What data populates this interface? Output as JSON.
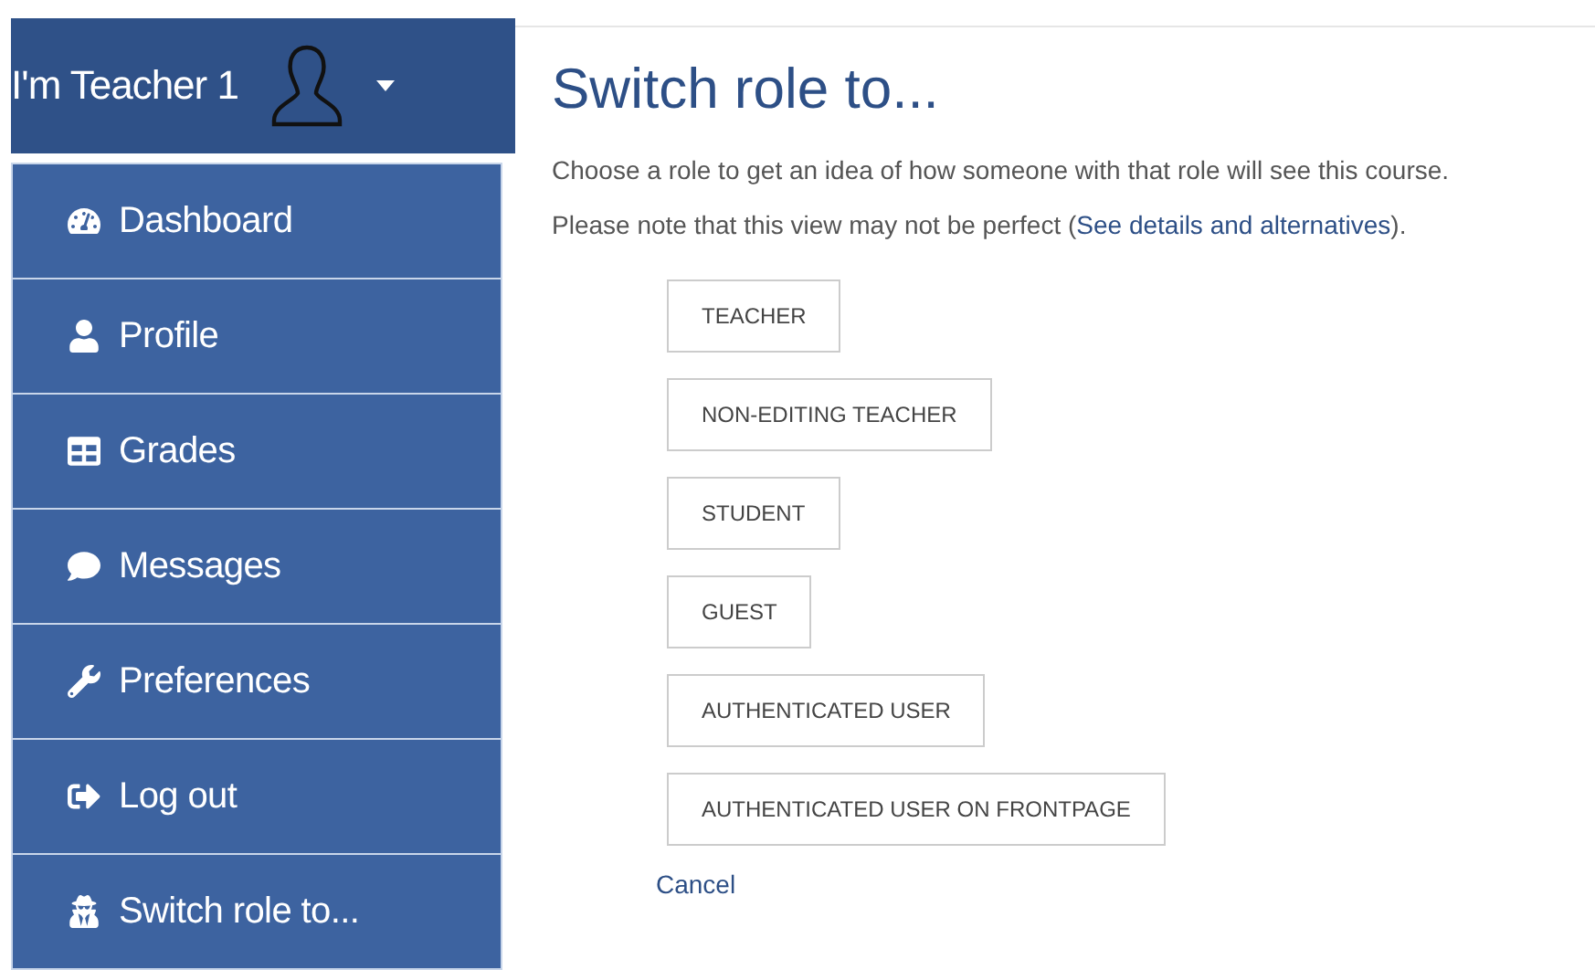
{
  "user_menu": {
    "name": "I'm Teacher 1",
    "items": [
      {
        "label": "Dashboard",
        "kind": "dashboard"
      },
      {
        "label": "Profile",
        "kind": "profile"
      },
      {
        "label": "Grades",
        "kind": "grades"
      },
      {
        "label": "Messages",
        "kind": "messages"
      },
      {
        "label": "Preferences",
        "kind": "preferences"
      },
      {
        "label": "Log out",
        "kind": "logout"
      },
      {
        "label": "Switch role to...",
        "kind": "switchrole"
      }
    ]
  },
  "page": {
    "title": "Switch role to...",
    "intro": "Choose a role to get an idea of how someone with that role will see this course.",
    "note": {
      "before": "Please note that this view may not be perfect (",
      "link": "See details and alternatives",
      "after": ")."
    },
    "roles": [
      "TEACHER",
      "NON-EDITING TEACHER",
      "STUDENT",
      "GUEST",
      "AUTHENTICATED USER",
      "AUTHENTICATED USER ON FRONTPAGE"
    ],
    "cancel": "Cancel"
  }
}
